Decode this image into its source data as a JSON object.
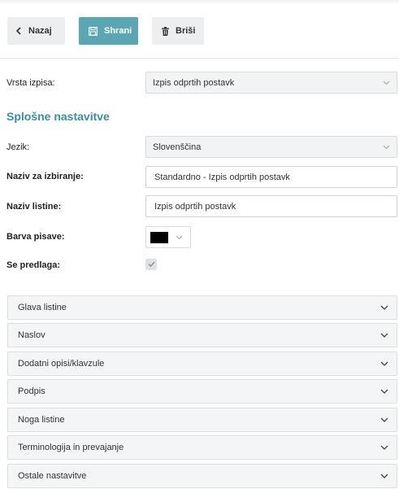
{
  "toolbar": {
    "back_label": "Nazaj",
    "save_label": "Shrani",
    "delete_label": "Briši"
  },
  "print_type": {
    "label": "Vrsta izpisa:",
    "value": "Izpis odprtih postavk"
  },
  "general_settings": {
    "title": "Splošne nastavitve",
    "language": {
      "label": "Jezik:",
      "value": "Slovenščina"
    },
    "selection_name": {
      "label": "Naziv za izbiranje:",
      "value": "Standardno - Izpis odprtih postavk"
    },
    "document_name": {
      "label": "Naziv listine:",
      "value": "Izpis odprtih postavk"
    },
    "font_color": {
      "label": "Barva pisave:",
      "value": "#000000"
    },
    "proposed": {
      "label": "Se predlaga:",
      "checked": true
    }
  },
  "accordion": [
    {
      "label": "Glava listine"
    },
    {
      "label": "Naslov"
    },
    {
      "label": "Dodatni opisi/klavzule"
    },
    {
      "label": "Podpis"
    },
    {
      "label": "Noga listine"
    },
    {
      "label": "Terminologija in prevajanje"
    },
    {
      "label": "Ostale nastavitve"
    }
  ],
  "colors": {
    "accent": "#5ba6b3",
    "section_title": "#3c8ea0"
  }
}
